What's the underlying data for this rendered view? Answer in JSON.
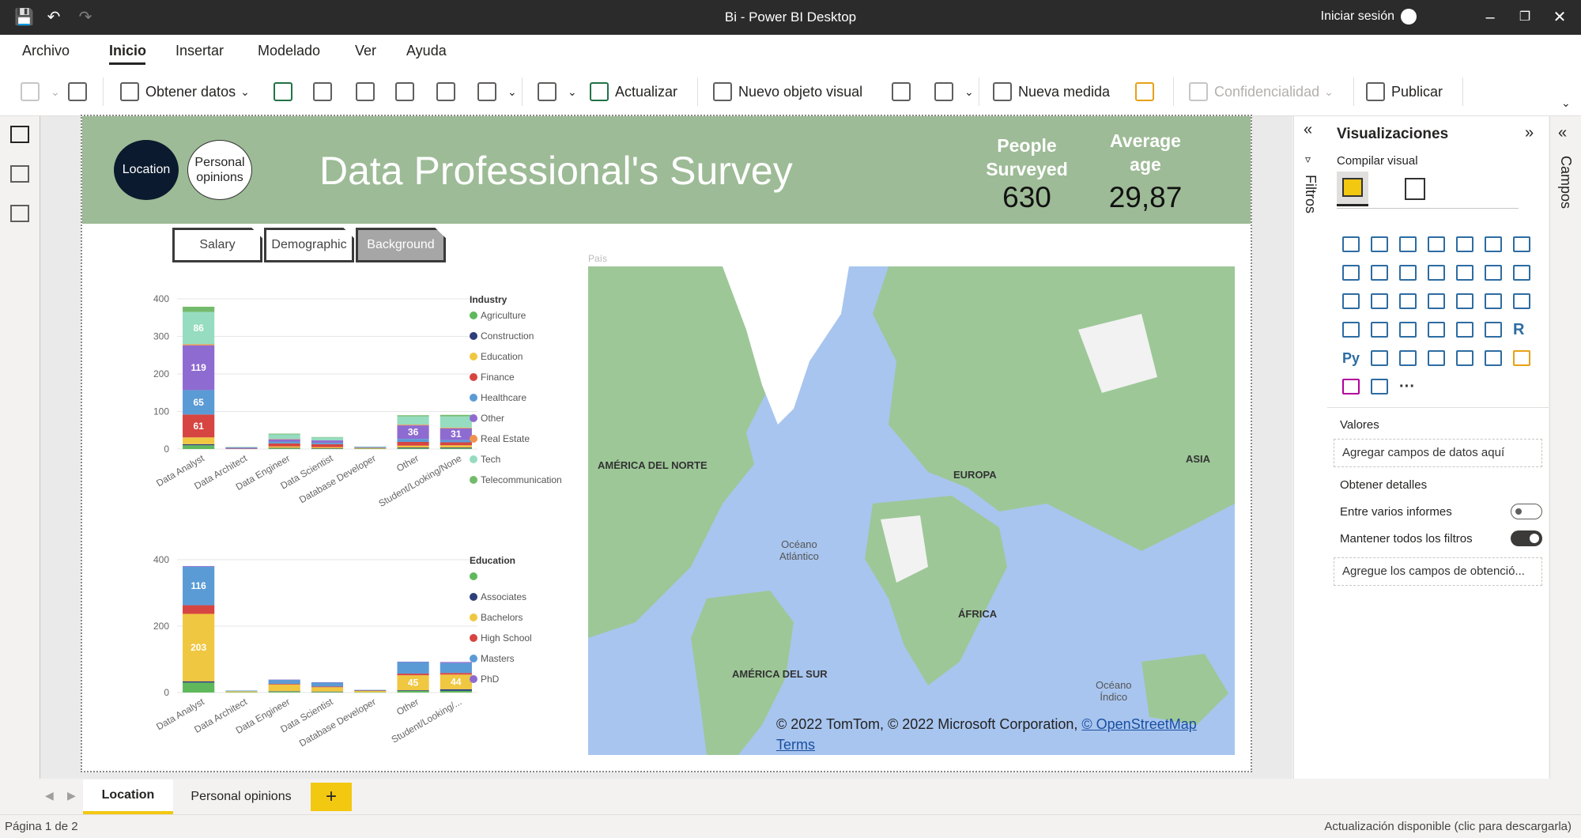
{
  "window": {
    "title": "Bi - Power BI Desktop",
    "signin": "Iniciar sesión"
  },
  "menu": {
    "items": [
      "Archivo",
      "Inicio",
      "Insertar",
      "Modelado",
      "Ver",
      "Ayuda"
    ],
    "active": "Inicio"
  },
  "ribbon": {
    "get_data": "Obtener datos",
    "refresh": "Actualizar",
    "new_visual": "Nuevo objeto visual",
    "new_measure": "Nueva medida",
    "sensitivity": "Confidencialidad",
    "publish": "Publicar"
  },
  "report": {
    "nav_location": "Location",
    "nav_opinions": "Personal opinions",
    "title": "Data Professional's Survey",
    "kpis": [
      {
        "label_line1": "People",
        "label_line2": "Surveyed",
        "value": "630"
      },
      {
        "label_line1": "Average",
        "label_line2": "age",
        "value": "29,87"
      }
    ],
    "tabs": [
      "Salary",
      "Demographic",
      "Background"
    ],
    "selected_tab": "Background"
  },
  "chart_data": [
    {
      "type": "bar",
      "stacked": true,
      "legend_title": "Industry",
      "categories": [
        "Data Analyst",
        "Data Architect",
        "Data Engineer",
        "Data Scientist",
        "Database Developer",
        "Other",
        "Student/Looking/None"
      ],
      "yticks": [
        "0",
        "100",
        "200",
        "300",
        "400"
      ],
      "ylim": [
        0,
        400
      ],
      "series": [
        {
          "name": "Agriculture",
          "color": "#5fb95c",
          "values": [
            10,
            0,
            2,
            1,
            1,
            2,
            2
          ]
        },
        {
          "name": "Construction",
          "color": "#2d3f7a",
          "values": [
            3,
            0,
            1,
            1,
            0,
            2,
            2
          ]
        },
        {
          "name": "Education",
          "color": "#f0c741",
          "values": [
            18,
            0,
            4,
            3,
            1,
            5,
            6
          ]
        },
        {
          "name": "Finance",
          "color": "#d64541",
          "values": [
            61,
            1,
            8,
            8,
            1,
            10,
            8
          ]
        },
        {
          "name": "Healthcare",
          "color": "#5b9bd5",
          "values": [
            65,
            1,
            5,
            4,
            1,
            8,
            6
          ]
        },
        {
          "name": "Other",
          "color": "#8e6bd0",
          "values": [
            119,
            2,
            6,
            6,
            1,
            36,
            31
          ]
        },
        {
          "name": "Real Estate",
          "color": "#f0924f",
          "values": [
            3,
            0,
            1,
            0,
            0,
            2,
            2
          ]
        },
        {
          "name": "Tech",
          "color": "#96dcc0",
          "values": [
            86,
            2,
            12,
            8,
            2,
            22,
            30
          ]
        },
        {
          "name": "Telecommunication",
          "color": "#73bb6c",
          "values": [
            14,
            0,
            2,
            1,
            0,
            3,
            4
          ]
        }
      ],
      "data_labels": [
        {
          "series": "Tech",
          "category": "Data Analyst",
          "text": "86"
        },
        {
          "series": "Other",
          "category": "Data Analyst",
          "text": "119"
        },
        {
          "series": "Healthcare",
          "category": "Data Analyst",
          "text": "65"
        },
        {
          "series": "Finance",
          "category": "Data Analyst",
          "text": "61"
        },
        {
          "series": "Other",
          "category": "Other",
          "text": "36"
        },
        {
          "series": "Other",
          "category": "Student/Looking/None",
          "text": "31"
        }
      ]
    },
    {
      "type": "bar",
      "stacked": true,
      "legend_title": "Education",
      "categories": [
        "Data Analyst",
        "Data Architect",
        "Data Engineer",
        "Data Scientist",
        "Database Developer",
        "Other",
        "Student/Looking/..."
      ],
      "yticks": [
        "0",
        "200",
        "400"
      ],
      "ylim": [
        0,
        400
      ],
      "series": [
        {
          "name": "",
          "color": "#5fb95c",
          "values": [
            30,
            1,
            3,
            2,
            1,
            5,
            5
          ]
        },
        {
          "name": "Associates",
          "color": "#2d3f7a",
          "values": [
            4,
            0,
            1,
            1,
            0,
            2,
            5
          ]
        },
        {
          "name": "Bachelors",
          "color": "#f0c741",
          "values": [
            203,
            3,
            20,
            13,
            4,
            45,
            44
          ]
        },
        {
          "name": "High School",
          "color": "#d64541",
          "values": [
            26,
            0,
            2,
            2,
            1,
            5,
            5
          ]
        },
        {
          "name": "Masters",
          "color": "#5b9bd5",
          "values": [
            116,
            2,
            12,
            12,
            2,
            35,
            30
          ]
        },
        {
          "name": "PhD",
          "color": "#8e6bd0",
          "values": [
            2,
            0,
            1,
            1,
            0,
            1,
            3
          ]
        }
      ],
      "data_labels": [
        {
          "series": "Masters",
          "category": "Data Analyst",
          "text": "116"
        },
        {
          "series": "Bachelors",
          "category": "Data Analyst",
          "text": "203"
        },
        {
          "series": "Bachelors",
          "category": "Other",
          "text": "45"
        },
        {
          "series": "Bachelors",
          "category": "Student/Looking/...",
          "text": "44"
        }
      ]
    }
  ],
  "map": {
    "caption": "País",
    "labels": [
      "AMÉRICA DEL NORTE",
      "EUROPA",
      "ASIA",
      "ÁFRICA",
      "AMÉRICA DEL SUR"
    ],
    "ocean_atlantic": [
      "Océano",
      "Atlántico"
    ],
    "ocean_indian": [
      "Océano",
      "Índico"
    ],
    "attribution": "© 2022 TomTom, © 2022 Microsoft Corporation,",
    "osm_link": "© OpenStreetMap",
    "terms_link": "Terms",
    "land_color": "#9dc797",
    "water_color": "#a8c5ef"
  },
  "filters_pane": {
    "label": "Filtros"
  },
  "viz_pane": {
    "title": "Visualizaciones",
    "build_visual": "Compilar visual",
    "values_label": "Valores",
    "values_placeholder": "Agregar campos de datos aquí",
    "drillthrough_label": "Obtener detalles",
    "cross_report": "Entre varios informes",
    "keep_filters": "Mantener todos los filtros",
    "drill_placeholder": "Agregue los campos de obtenció...",
    "icon_text_r": "R",
    "icon_text_py": "Py",
    "icon_text_more": "···"
  },
  "fields_pane": {
    "label": "Campos"
  },
  "pages": {
    "tabs": [
      "Location",
      "Personal opinions"
    ],
    "active": "Location",
    "add": "+"
  },
  "status": {
    "page": "Página 1 de 2",
    "update": "Actualización disponible (clic para descargarla)"
  }
}
